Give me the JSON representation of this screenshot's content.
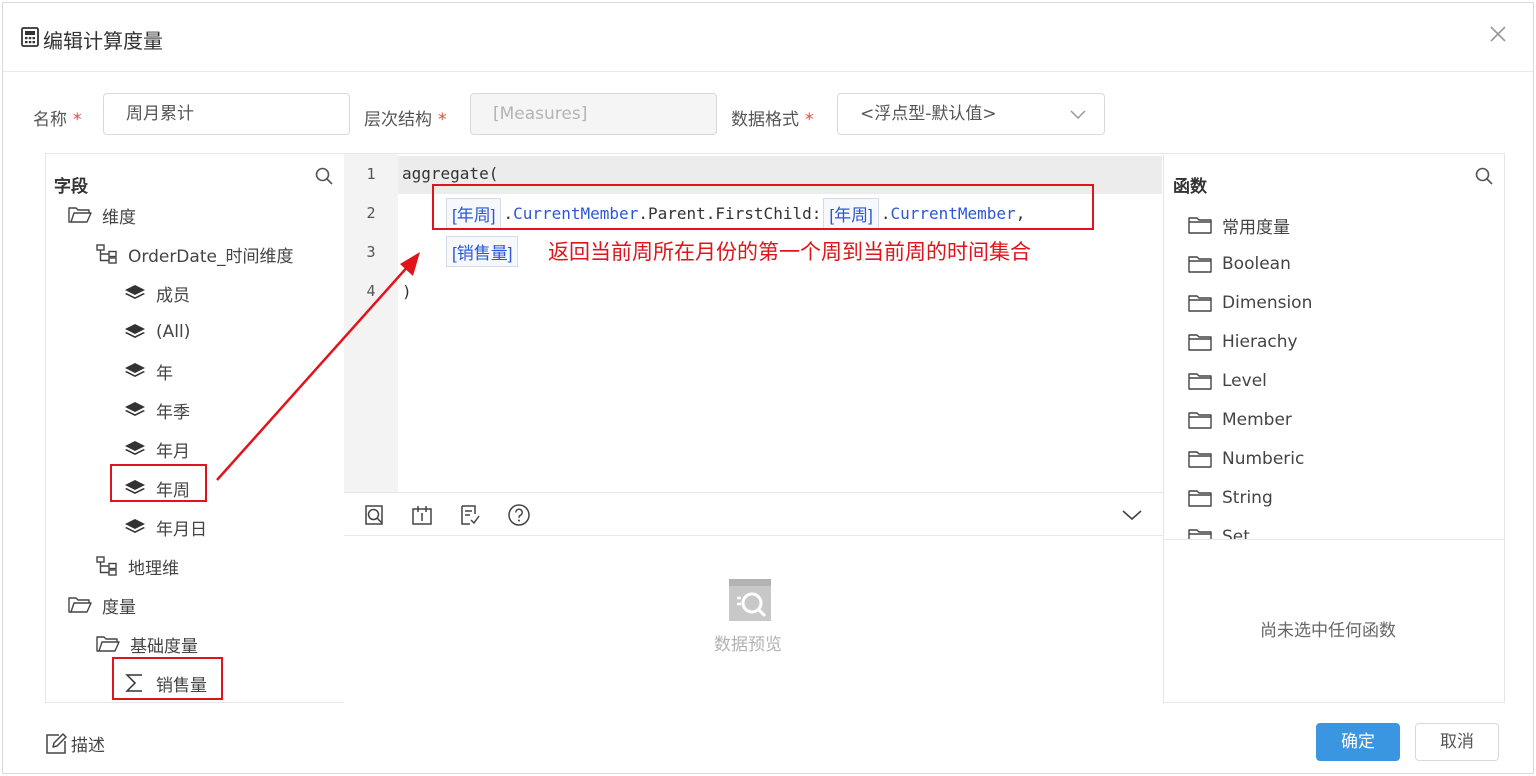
{
  "dialog": {
    "title": "编辑计算度量",
    "icons": {
      "title": "calculator-icon",
      "close": "close-icon"
    }
  },
  "form": {
    "name_label": "名称",
    "name_value": "周月累计",
    "hierarchy_label": "层次结构",
    "hierarchy_value": "[Measures]",
    "format_label": "数据格式",
    "format_value": "<浮点型-默认值>",
    "required_mark": "*"
  },
  "fields_panel": {
    "title": "字段",
    "items": [
      {
        "label": "维度",
        "icon": "folder-open-icon"
      },
      {
        "label": "OrderDate_时间维度",
        "icon": "hierarchy-icon"
      },
      {
        "label": "成员",
        "icon": "layers-icon"
      },
      {
        "label": "(All)",
        "icon": "layers-icon"
      },
      {
        "label": "年",
        "icon": "layers-icon"
      },
      {
        "label": "年季",
        "icon": "layers-icon"
      },
      {
        "label": "年月",
        "icon": "layers-icon"
      },
      {
        "label": "年周",
        "icon": "layers-icon"
      },
      {
        "label": "年月日",
        "icon": "layers-icon"
      },
      {
        "label": "地理维",
        "icon": "hierarchy-icon"
      },
      {
        "label": "度量",
        "icon": "folder-open-icon"
      },
      {
        "label": "基础度量",
        "icon": "folder-open-icon"
      },
      {
        "label": "销售量",
        "icon": "sigma-icon"
      }
    ]
  },
  "editor": {
    "line_numbers": [
      "1",
      "2",
      "3",
      "4"
    ],
    "line1": "aggregate(",
    "line2": {
      "tok1": "[年周]",
      "text1": ".",
      "text2": "CurrentMember",
      "text3": ".Parent.FirstChild:",
      "tok2": "[年周]",
      "text4": ".",
      "text5": "CurrentMember",
      "text6": ","
    },
    "line3_tok": "[销售量]",
    "line4": ")",
    "annotation": "返回当前周所在月份的第一个周到当前周的时间集合"
  },
  "toolbar": {
    "icons": [
      "preview-search-icon",
      "calendar-icon",
      "validate-icon",
      "help-icon",
      "chevron-down-icon"
    ]
  },
  "preview": {
    "label": "数据预览",
    "icon": "data-preview-icon"
  },
  "functions_panel": {
    "title": "函数",
    "items": [
      "常用度量",
      "Boolean",
      "Dimension",
      "Hierachy",
      "Level",
      "Member",
      "Numberic",
      "String",
      "Set"
    ],
    "empty_text": "尚未选中任何函数"
  },
  "footer": {
    "describe_label": "描述",
    "ok_label": "确定",
    "cancel_label": "取消"
  },
  "colors": {
    "accent": "#3a96e0",
    "annotation": "#e0141b",
    "code_token": "#2a57d8",
    "required": "#e8463b"
  }
}
